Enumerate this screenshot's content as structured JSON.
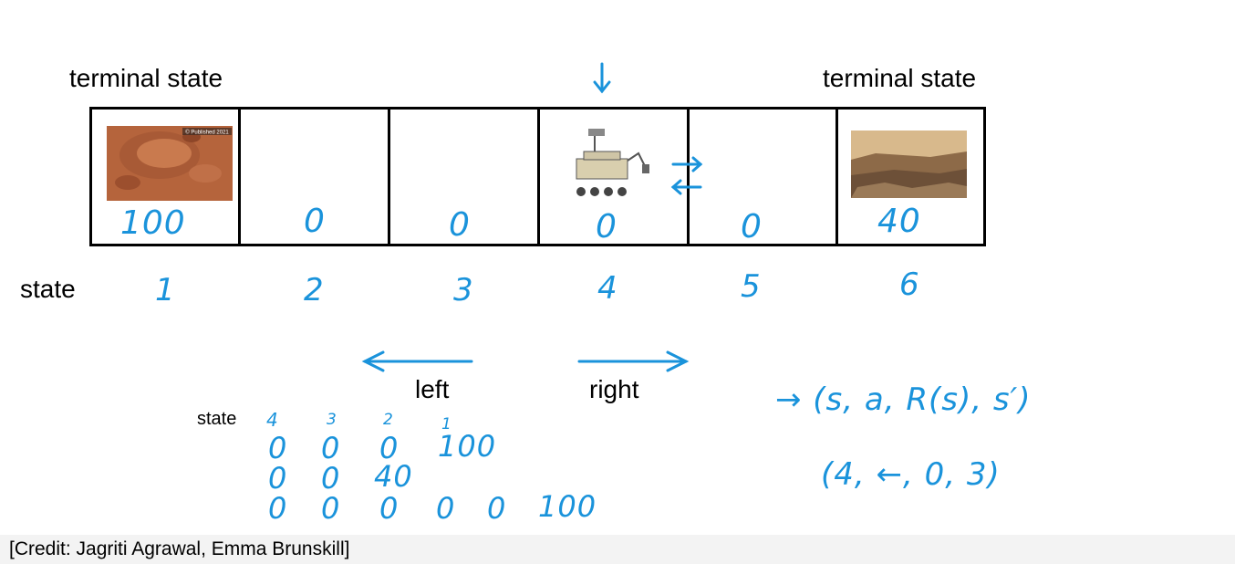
{
  "terminal_left_label": "terminal state",
  "terminal_right_label": "terminal state",
  "state_row_label": "state",
  "cells": [
    {
      "state": "1",
      "reward": "100",
      "image": "mars-crater-photo",
      "image_caption": "© Published 2021"
    },
    {
      "state": "2",
      "reward": "0"
    },
    {
      "state": "3",
      "reward": "0"
    },
    {
      "state": "4",
      "reward": "0",
      "image": "mars-rover-illustration"
    },
    {
      "state": "5",
      "reward": "0"
    },
    {
      "state": "6",
      "reward": "40",
      "image": "mars-landscape-photo"
    }
  ],
  "actions": {
    "left": "left",
    "right": "right"
  },
  "trajectory_table": {
    "label": "state",
    "header": [
      "4",
      "3",
      "2",
      "1"
    ],
    "rows": [
      [
        "0",
        "0",
        "0",
        "100"
      ],
      [
        "0",
        "0",
        "40"
      ],
      [
        "0",
        "0",
        "0",
        "0",
        "0",
        "100"
      ]
    ]
  },
  "tuple_formula": "→ (s, a, R(s), s′)",
  "tuple_example": "(4, ←, 0, 3)",
  "credit": "[Credit: Jagriti Agrawal, Emma Brunskill]",
  "colors": {
    "ink": "#1a93db",
    "grid": "#000000"
  }
}
